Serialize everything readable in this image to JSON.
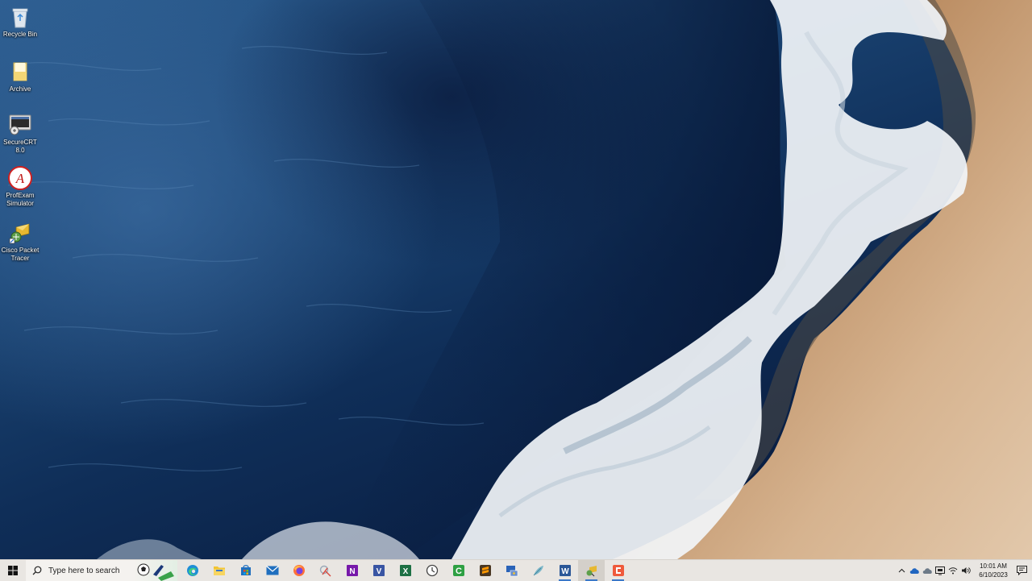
{
  "desktop": {
    "icons": [
      {
        "label": "Recycle Bin",
        "icon": "recycle-bin-icon"
      },
      {
        "label": "Archive",
        "icon": "folder-icon"
      },
      {
        "label": "SecureCRT 8.0",
        "icon": "securecrt-icon"
      },
      {
        "label": "ProfExam Simulator",
        "icon": "profexam-icon"
      },
      {
        "label": "Cisco Packet Tracer",
        "icon": "packet-tracer-icon"
      }
    ]
  },
  "taskbar": {
    "search_placeholder": "Type here to search",
    "pinned": [
      {
        "name": "edge",
        "icon": "edge-icon"
      },
      {
        "name": "file-explorer",
        "icon": "folder-icon"
      },
      {
        "name": "microsoft-store",
        "icon": "store-icon"
      },
      {
        "name": "mail",
        "icon": "mail-icon"
      },
      {
        "name": "firefox",
        "icon": "firefox-icon"
      },
      {
        "name": "snipping-tool",
        "icon": "snipping-tool-icon"
      },
      {
        "name": "onenote",
        "icon": "onenote-icon"
      },
      {
        "name": "visio",
        "icon": "visio-icon"
      },
      {
        "name": "excel",
        "icon": "excel-icon"
      },
      {
        "name": "clock-app",
        "icon": "clock-icon"
      },
      {
        "name": "camtasia",
        "icon": "camtasia-icon"
      },
      {
        "name": "sublime-text",
        "icon": "sublime-icon"
      },
      {
        "name": "remote-desktop",
        "icon": "remote-desktop-icon"
      },
      {
        "name": "feather-app",
        "icon": "feather-icon"
      },
      {
        "name": "word",
        "icon": "word-icon"
      },
      {
        "name": "packet-tracer",
        "icon": "packet-tracer-icon"
      },
      {
        "name": "recorder",
        "icon": "recorder-icon"
      }
    ],
    "tray": {
      "icons": [
        "chevron-up-icon",
        "onedrive-icon",
        "onedrive-2-icon",
        "display-icon",
        "network-icon",
        "volume-icon"
      ],
      "time": "10:01 AM",
      "date": "6/10/2023"
    }
  },
  "colors": {
    "taskbar_bg": "#e9e6e2",
    "accent": "#3b78c8"
  }
}
